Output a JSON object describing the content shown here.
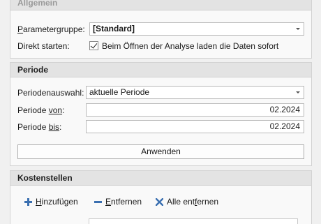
{
  "allgemein": {
    "title": "Allgemein",
    "parametergruppe_label": "Parametergruppe:",
    "parametergruppe_value": "[Standard]",
    "direkt_starten_label": "Direkt starten:",
    "direkt_starten_checkbox_label": "Beim Öffnen der Analyse laden die Daten sofort",
    "direkt_starten_checked": true
  },
  "periode": {
    "title": "Periode",
    "periodenauswahl_label": "Periodenauswahl:",
    "periodenauswahl_value": "aktuelle Periode",
    "periode_von_label_pre": "Periode ",
    "periode_von_label_u": "von",
    "periode_von_label_post": ":",
    "periode_von_value": "02.2024",
    "periode_bis_label_pre": "Periode ",
    "periode_bis_label_u": "bis",
    "periode_bis_label_post": ":",
    "periode_bis_value": "02.2024",
    "anwenden_label": "Anwenden"
  },
  "kostenstellen": {
    "title": "Kostenstellen",
    "hinzufuegen_u": "H",
    "hinzufuegen_rest": "inzufügen",
    "entfernen_u": "E",
    "entfernen_rest": "ntfernen",
    "alle_entfernen_pre": "Alle ent",
    "alle_entfernen_u": "f",
    "alle_entfernen_post": "ernen"
  },
  "colors": {
    "add_icon": "#3a6fb0",
    "remove_icon": "#3a6fb0",
    "delete_icon": "#3a6fb0"
  }
}
